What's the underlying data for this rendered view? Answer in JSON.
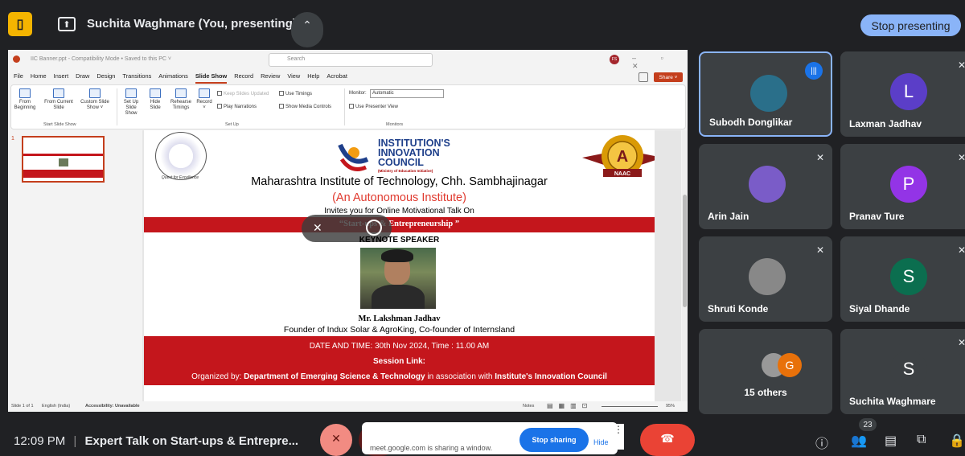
{
  "topbar": {
    "presenting_text": "Suchita Waghmare (You, presenting)",
    "stop_button": "Stop presenting"
  },
  "ppt": {
    "file_title": "IIC Banner.ppt - Compatibility Mode • Saved to this PC ˅",
    "search_placeholder": "Search",
    "avatar_initials": "FS",
    "window_controls": "– ▫ ✕",
    "menu": [
      "File",
      "Home",
      "Insert",
      "Draw",
      "Design",
      "Transitions",
      "Animations",
      "Slide Show",
      "Record",
      "Review",
      "View",
      "Help",
      "Acrobat"
    ],
    "active_menu": "Slide Show",
    "share_label": "Share ˅",
    "ribbon": {
      "from_beginning": "From Beginning",
      "from_current": "From Current Slide",
      "custom_show": "Custom Slide Show ˅",
      "set_up": "Set Up Slide Show",
      "hide_slide": "Hide Slide",
      "rehearse": "Rehearse Timings",
      "record": "Record ˅",
      "keep_updated": "Keep Slides Updated",
      "play_narrations": "Play Narrations",
      "use_timings": "Use Timings",
      "show_media": "Show Media Controls",
      "monitor_label": "Monitor:",
      "monitor_value": "Automatic",
      "presenter_view": "Use Presenter View",
      "group_start": "Start Slide Show",
      "group_setup": "Set Up",
      "group_monitors": "Monitors"
    },
    "status": {
      "slide_of": "Slide 1 of 1",
      "language": "English (India)",
      "accessibility": "Accessibility: Unavailable",
      "notes": "Notes",
      "zoom": "95%"
    },
    "thumb_number": "1"
  },
  "slide": {
    "seal_tagline": "Quest for Excellence",
    "iic_line1": "INSTITUTION'S",
    "iic_line2": "INNOVATION",
    "iic_line3": "COUNCIL",
    "iic_sub": "(Ministry of Education Initiative)",
    "naac_grade": "A",
    "naac_label": "NAAC",
    "institute": "Maharashtra Institute of Technology, Chh. Sambhajinagar",
    "autonomous": "(An Autonomous Institute)",
    "invites": "Invites you  for Online Motivational Talk On",
    "talk_title": "“Start-ups & Entrepreneurship ”",
    "keynote": "KEYNOTE SPEAKER",
    "speaker_name": "Mr. Lakshman Jadhav",
    "speaker_role": "Founder of Indux Solar & AgroKing, Co-founder of Internsland",
    "date_time": "DATE AND TIME: 30th Nov 2024, Time : 11.00 AM",
    "session_link": "Session Link:",
    "organized_prefix": "Organized by: ",
    "organized_dept": "Department of Emerging Science & Technology",
    "organized_mid": " in association with ",
    "organized_council": "Institute's Innovation Council"
  },
  "participants": [
    {
      "name": "Subodh Donglikar",
      "avatar": "",
      "color": "#2a6f8a",
      "speaking": true
    },
    {
      "name": "Laxman Jadhav",
      "avatar": "L",
      "color": "#5b3ec8",
      "speaking": false
    },
    {
      "name": "Arin Jain",
      "avatar": "",
      "color": "#7a5cc8",
      "speaking": false
    },
    {
      "name": "Pranav Ture",
      "avatar": "P",
      "color": "#9334e6",
      "speaking": false
    },
    {
      "name": "Shruti Konde",
      "avatar": "",
      "color": "#888888",
      "speaking": false
    },
    {
      "name": "Siyal Dhande",
      "avatar": "S",
      "color": "#0b6e4f",
      "speaking": false
    },
    {
      "name": "15 others",
      "avatar": "G",
      "color": "#e8710a",
      "speaking": false
    },
    {
      "name": "Suchita Waghmare",
      "avatar": "S",
      "color": "#3c4043",
      "speaking": false
    }
  ],
  "bottombar": {
    "time": "12:09 PM",
    "separator": "|",
    "meeting_title": "Expert Talk on Start-ups & Entrepre...",
    "sharing_notice": "meet.google.com is sharing a window.",
    "notice_stop": "Stop sharing",
    "notice_hide": "Hide",
    "people_count": "23"
  }
}
